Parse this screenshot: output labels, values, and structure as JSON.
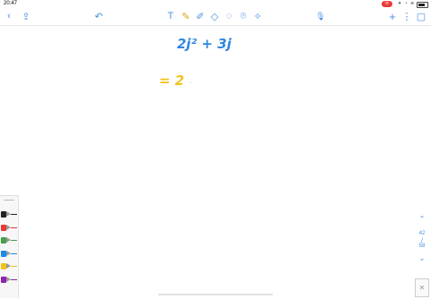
{
  "statusbar": {
    "time": "20:47",
    "record_badge": "⦿",
    "icons": "✦ ◔ ≋"
  },
  "toolbar": {
    "back": "‹",
    "share": "⇪",
    "undo": "↶",
    "text_tool": "T",
    "pen_tool": "✎",
    "highlighter_tool": "✐",
    "eraser_tool": "◇",
    "lasso_tool": "◌",
    "shapes_tool": "⌾",
    "laser_tool": "✧",
    "mic": "🎙",
    "add": "+",
    "more": "⋮",
    "pages": "▢"
  },
  "canvas": {
    "line1": "2j² + 3j",
    "line2_eq": "= 2",
    "line2_cursor": "·"
  },
  "palette": {
    "colors": [
      "#222222",
      "#e53935",
      "#43a047",
      "#1e88e5",
      "#f2c218",
      "#8e24aa"
    ]
  },
  "pager": {
    "up": "⌃",
    "current": "42",
    "separator": "/",
    "total": "58",
    "down": "⌄"
  },
  "thumbnail": {
    "label": "✕"
  },
  "colors": {
    "accent": "#4a8fe0",
    "ink_blue": "#2f86e0",
    "ink_yellow": "#f2c218"
  }
}
